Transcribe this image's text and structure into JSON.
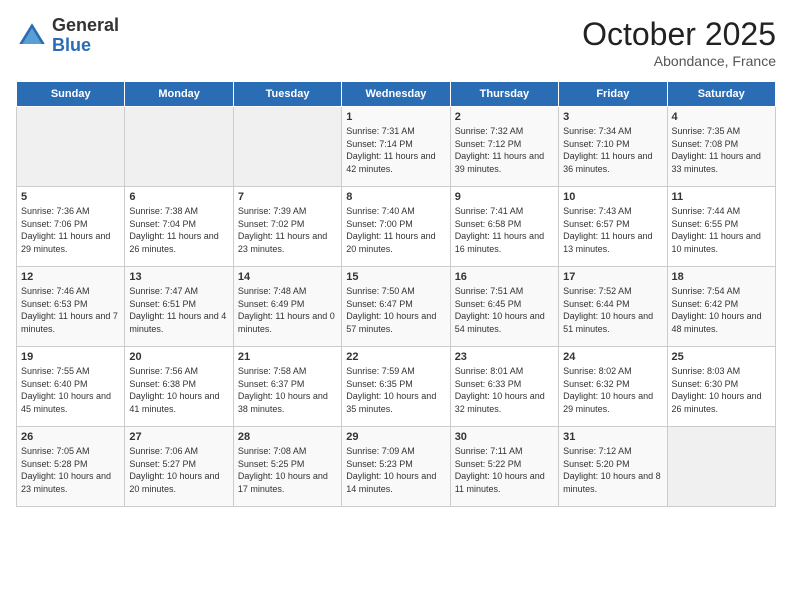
{
  "header": {
    "logo_general": "General",
    "logo_blue": "Blue",
    "month_title": "October 2025",
    "location": "Abondance, France"
  },
  "days_of_week": [
    "Sunday",
    "Monday",
    "Tuesday",
    "Wednesday",
    "Thursday",
    "Friday",
    "Saturday"
  ],
  "weeks": [
    [
      {
        "day": "",
        "sunrise": "",
        "sunset": "",
        "daylight": "",
        "empty": true
      },
      {
        "day": "",
        "sunrise": "",
        "sunset": "",
        "daylight": "",
        "empty": true
      },
      {
        "day": "",
        "sunrise": "",
        "sunset": "",
        "daylight": "",
        "empty": true
      },
      {
        "day": "1",
        "sunrise": "Sunrise: 7:31 AM",
        "sunset": "Sunset: 7:14 PM",
        "daylight": "Daylight: 11 hours and 42 minutes."
      },
      {
        "day": "2",
        "sunrise": "Sunrise: 7:32 AM",
        "sunset": "Sunset: 7:12 PM",
        "daylight": "Daylight: 11 hours and 39 minutes."
      },
      {
        "day": "3",
        "sunrise": "Sunrise: 7:34 AM",
        "sunset": "Sunset: 7:10 PM",
        "daylight": "Daylight: 11 hours and 36 minutes."
      },
      {
        "day": "4",
        "sunrise": "Sunrise: 7:35 AM",
        "sunset": "Sunset: 7:08 PM",
        "daylight": "Daylight: 11 hours and 33 minutes."
      }
    ],
    [
      {
        "day": "5",
        "sunrise": "Sunrise: 7:36 AM",
        "sunset": "Sunset: 7:06 PM",
        "daylight": "Daylight: 11 hours and 29 minutes."
      },
      {
        "day": "6",
        "sunrise": "Sunrise: 7:38 AM",
        "sunset": "Sunset: 7:04 PM",
        "daylight": "Daylight: 11 hours and 26 minutes."
      },
      {
        "day": "7",
        "sunrise": "Sunrise: 7:39 AM",
        "sunset": "Sunset: 7:02 PM",
        "daylight": "Daylight: 11 hours and 23 minutes."
      },
      {
        "day": "8",
        "sunrise": "Sunrise: 7:40 AM",
        "sunset": "Sunset: 7:00 PM",
        "daylight": "Daylight: 11 hours and 20 minutes."
      },
      {
        "day": "9",
        "sunrise": "Sunrise: 7:41 AM",
        "sunset": "Sunset: 6:58 PM",
        "daylight": "Daylight: 11 hours and 16 minutes."
      },
      {
        "day": "10",
        "sunrise": "Sunrise: 7:43 AM",
        "sunset": "Sunset: 6:57 PM",
        "daylight": "Daylight: 11 hours and 13 minutes."
      },
      {
        "day": "11",
        "sunrise": "Sunrise: 7:44 AM",
        "sunset": "Sunset: 6:55 PM",
        "daylight": "Daylight: 11 hours and 10 minutes."
      }
    ],
    [
      {
        "day": "12",
        "sunrise": "Sunrise: 7:46 AM",
        "sunset": "Sunset: 6:53 PM",
        "daylight": "Daylight: 11 hours and 7 minutes."
      },
      {
        "day": "13",
        "sunrise": "Sunrise: 7:47 AM",
        "sunset": "Sunset: 6:51 PM",
        "daylight": "Daylight: 11 hours and 4 minutes."
      },
      {
        "day": "14",
        "sunrise": "Sunrise: 7:48 AM",
        "sunset": "Sunset: 6:49 PM",
        "daylight": "Daylight: 11 hours and 0 minutes."
      },
      {
        "day": "15",
        "sunrise": "Sunrise: 7:50 AM",
        "sunset": "Sunset: 6:47 PM",
        "daylight": "Daylight: 10 hours and 57 minutes."
      },
      {
        "day": "16",
        "sunrise": "Sunrise: 7:51 AM",
        "sunset": "Sunset: 6:45 PM",
        "daylight": "Daylight: 10 hours and 54 minutes."
      },
      {
        "day": "17",
        "sunrise": "Sunrise: 7:52 AM",
        "sunset": "Sunset: 6:44 PM",
        "daylight": "Daylight: 10 hours and 51 minutes."
      },
      {
        "day": "18",
        "sunrise": "Sunrise: 7:54 AM",
        "sunset": "Sunset: 6:42 PM",
        "daylight": "Daylight: 10 hours and 48 minutes."
      }
    ],
    [
      {
        "day": "19",
        "sunrise": "Sunrise: 7:55 AM",
        "sunset": "Sunset: 6:40 PM",
        "daylight": "Daylight: 10 hours and 45 minutes."
      },
      {
        "day": "20",
        "sunrise": "Sunrise: 7:56 AM",
        "sunset": "Sunset: 6:38 PM",
        "daylight": "Daylight: 10 hours and 41 minutes."
      },
      {
        "day": "21",
        "sunrise": "Sunrise: 7:58 AM",
        "sunset": "Sunset: 6:37 PM",
        "daylight": "Daylight: 10 hours and 38 minutes."
      },
      {
        "day": "22",
        "sunrise": "Sunrise: 7:59 AM",
        "sunset": "Sunset: 6:35 PM",
        "daylight": "Daylight: 10 hours and 35 minutes."
      },
      {
        "day": "23",
        "sunrise": "Sunrise: 8:01 AM",
        "sunset": "Sunset: 6:33 PM",
        "daylight": "Daylight: 10 hours and 32 minutes."
      },
      {
        "day": "24",
        "sunrise": "Sunrise: 8:02 AM",
        "sunset": "Sunset: 6:32 PM",
        "daylight": "Daylight: 10 hours and 29 minutes."
      },
      {
        "day": "25",
        "sunrise": "Sunrise: 8:03 AM",
        "sunset": "Sunset: 6:30 PM",
        "daylight": "Daylight: 10 hours and 26 minutes."
      }
    ],
    [
      {
        "day": "26",
        "sunrise": "Sunrise: 7:05 AM",
        "sunset": "Sunset: 5:28 PM",
        "daylight": "Daylight: 10 hours and 23 minutes."
      },
      {
        "day": "27",
        "sunrise": "Sunrise: 7:06 AM",
        "sunset": "Sunset: 5:27 PM",
        "daylight": "Daylight: 10 hours and 20 minutes."
      },
      {
        "day": "28",
        "sunrise": "Sunrise: 7:08 AM",
        "sunset": "Sunset: 5:25 PM",
        "daylight": "Daylight: 10 hours and 17 minutes."
      },
      {
        "day": "29",
        "sunrise": "Sunrise: 7:09 AM",
        "sunset": "Sunset: 5:23 PM",
        "daylight": "Daylight: 10 hours and 14 minutes."
      },
      {
        "day": "30",
        "sunrise": "Sunrise: 7:11 AM",
        "sunset": "Sunset: 5:22 PM",
        "daylight": "Daylight: 10 hours and 11 minutes."
      },
      {
        "day": "31",
        "sunrise": "Sunrise: 7:12 AM",
        "sunset": "Sunset: 5:20 PM",
        "daylight": "Daylight: 10 hours and 8 minutes."
      },
      {
        "day": "",
        "sunrise": "",
        "sunset": "",
        "daylight": "",
        "empty": true
      }
    ]
  ]
}
